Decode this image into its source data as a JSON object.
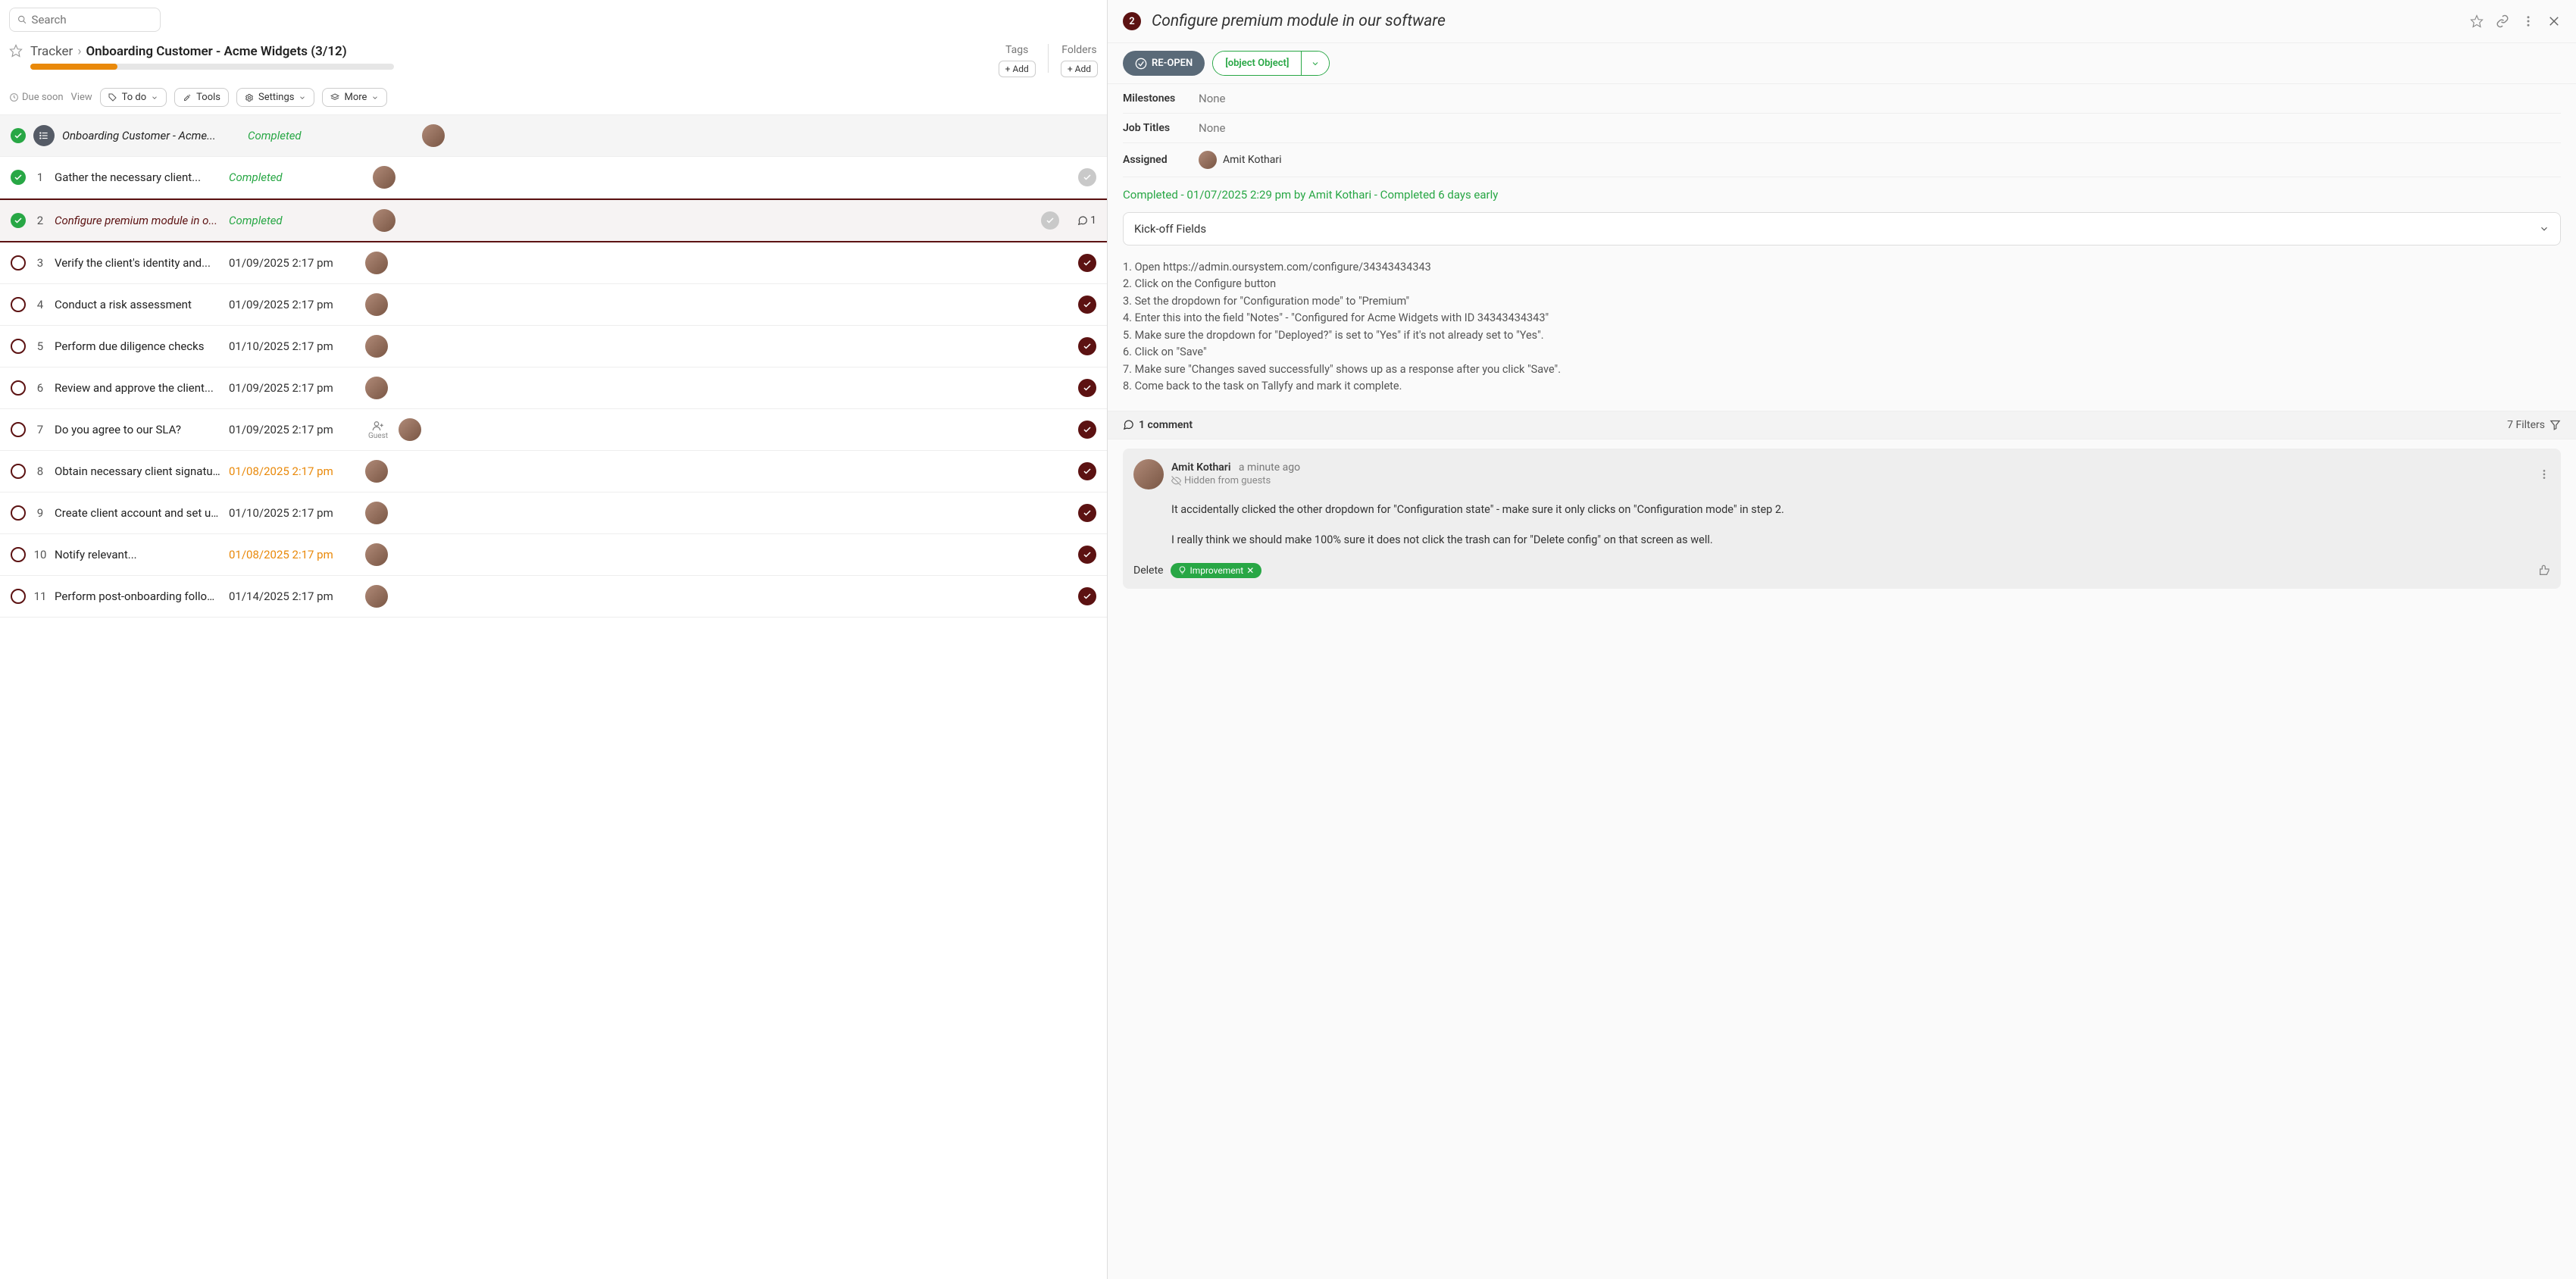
{
  "search": {
    "placeholder": "Search"
  },
  "breadcrumb": {
    "root": "Tracker",
    "current": "Onboarding Customer - Acme Widgets (3/12)"
  },
  "tags": {
    "label": "Tags",
    "add": "Add"
  },
  "folders": {
    "label": "Folders",
    "add": "Add"
  },
  "toolbar": {
    "due": "Due soon",
    "view": "View",
    "todo": "To do",
    "tools": "Tools",
    "settings": "Settings",
    "more": "More"
  },
  "header_task": {
    "title": "Onboarding Customer - Acme...",
    "status": "Completed"
  },
  "tasks": [
    {
      "num": "1",
      "title": "Gather the necessary client...",
      "status": "Completed",
      "date": "",
      "done": true
    },
    {
      "num": "2",
      "title": "Configure premium module in o...",
      "status": "Completed",
      "date": "",
      "done": true,
      "selected": true,
      "comments": "1"
    },
    {
      "num": "3",
      "title": "Verify the client's identity and...",
      "status": "",
      "date": "01/09/2025 2:17 pm",
      "done": false
    },
    {
      "num": "4",
      "title": "Conduct a risk assessment",
      "status": "",
      "date": "01/09/2025 2:17 pm",
      "done": false
    },
    {
      "num": "5",
      "title": "Perform due diligence checks",
      "status": "",
      "date": "01/10/2025 2:17 pm",
      "done": false
    },
    {
      "num": "6",
      "title": "Review and approve the client...",
      "status": "",
      "date": "01/09/2025 2:17 pm",
      "done": false
    },
    {
      "num": "7",
      "title": "Do you agree to our SLA?",
      "status": "",
      "date": "01/09/2025 2:17 pm",
      "done": false,
      "guest": true
    },
    {
      "num": "8",
      "title": "Obtain necessary client signatures",
      "status": "",
      "date": "01/08/2025 2:17 pm",
      "done": false,
      "warn": true
    },
    {
      "num": "9",
      "title": "Create client account and set up...",
      "status": "",
      "date": "01/10/2025 2:17 pm",
      "done": false
    },
    {
      "num": "10",
      "title": "Notify relevant...",
      "status": "",
      "date": "01/08/2025 2:17 pm",
      "done": false,
      "warn": true
    },
    {
      "num": "11",
      "title": "Perform post-onboarding follow...",
      "status": "",
      "date": "01/14/2025 2:17 pm",
      "done": false
    }
  ],
  "guest_label": "Guest",
  "detail": {
    "num": "2",
    "title": "Configure premium module in our software",
    "reopen": "RE-OPEN",
    "comment": {
      "author": "Amit Kothari",
      "time": "a minute ago",
      "hidden": "Hidden from guests",
      "body1": "It accidentally clicked the other dropdown for \"Configuration state\" - make sure it only clicks on \"Configuration mode\" in step 2.",
      "body2": "I really think we should make 100% sure it does not click the trash can for \"Delete config\" on that screen as well.",
      "delete": "Delete",
      "tag": "Improvement"
    },
    "milestones_k": "Milestones",
    "milestones_v": "None",
    "jobtitles_k": "Job Titles",
    "jobtitles_v": "None",
    "assigned_k": "Assigned",
    "assigned_name": "Amit Kothari",
    "completed_line": "Completed - 01/07/2025 2:29 pm by Amit Kothari - Completed 6 days early",
    "kickoff": "Kick-off Fields",
    "instructions": [
      "1. Open https://admin.oursystem.com/configure/34343434343",
      "2. Click on the Configure button",
      "3. Set the dropdown for \"Configuration mode\" to \"Premium\"",
      "4. Enter this into the field \"Notes\" - \"Configured for Acme Widgets with ID 34343434343\"",
      "5. Make sure the dropdown for \"Deployed?\" is set to \"Yes\" if it's not already set to \"Yes\".",
      "6. Click on \"Save\"",
      "7. Make sure \"Changes saved successfully\" shows up as a response after you click \"Save\".",
      "8. Come back to the task on Tallyfy and mark it complete."
    ],
    "comments_label": "1 comment",
    "filters": "7 Filters"
  }
}
